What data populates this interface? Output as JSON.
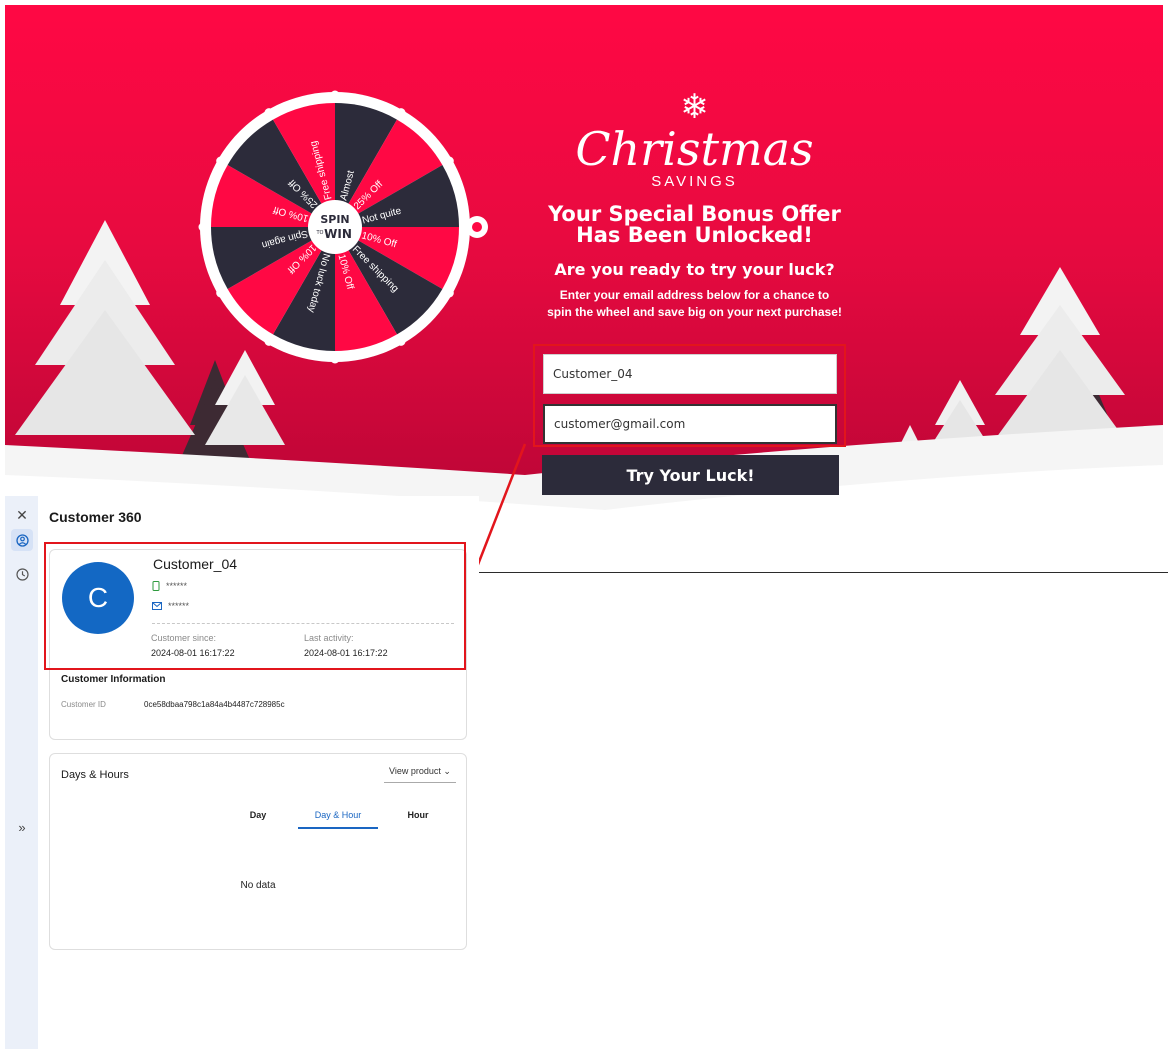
{
  "promo": {
    "logo_main": "Christmas",
    "logo_sub": "SAVINGS",
    "headline_line1": "Your Special Bonus Offer",
    "headline_line2": "Has Been Unlocked!",
    "subheadline": "Are you ready to try your luck?",
    "description": "Enter your email address below for a chance to spin the wheel and save big on your next purchase!",
    "name_value": "Customer_04",
    "email_value": "customer@gmail.com",
    "cta_label": "Try Your Luck!"
  },
  "wheel": {
    "hub_top": "SPIN",
    "hub_mid": "TO",
    "hub_bottom": "WIN",
    "segments": [
      "Almost",
      "25% Off",
      "Not quite",
      "10% Off",
      "Free shipping",
      "10% Off",
      "No luck today",
      "10% Off",
      "Spin again",
      "10% Off",
      "25% Off",
      "Free shipping"
    ],
    "colors": {
      "red": "#ff0844",
      "dark": "#2c2b3a",
      "rim": "#ffffff"
    }
  },
  "panel": {
    "title": "Customer 360",
    "nav": {
      "close": "close-icon",
      "profile": "profile-icon",
      "history": "clock-icon",
      "expand": "»"
    },
    "customer": {
      "avatar_letter": "C",
      "name": "Customer_04",
      "phone_masked": "******",
      "email_masked": "******",
      "since_label": "Customer since:",
      "since_value": "2024-08-01 16:17:22",
      "last_label": "Last activity:",
      "last_value": "2024-08-01 16:17:22"
    },
    "info": {
      "title": "Customer Information",
      "id_label": "Customer ID",
      "id_value": "0ce58dbaa798c1a84a4b4487c728985c"
    },
    "days": {
      "title": "Days & Hours",
      "dropdown_label": "View product",
      "tabs": [
        "Day",
        "Day & Hour",
        "Hour"
      ],
      "active_tab": 1,
      "empty_text": "No data"
    }
  },
  "colors": {
    "brand_red": "#ff0844",
    "accent_blue": "#1a66c2",
    "annotation_red": "#e2151c"
  }
}
